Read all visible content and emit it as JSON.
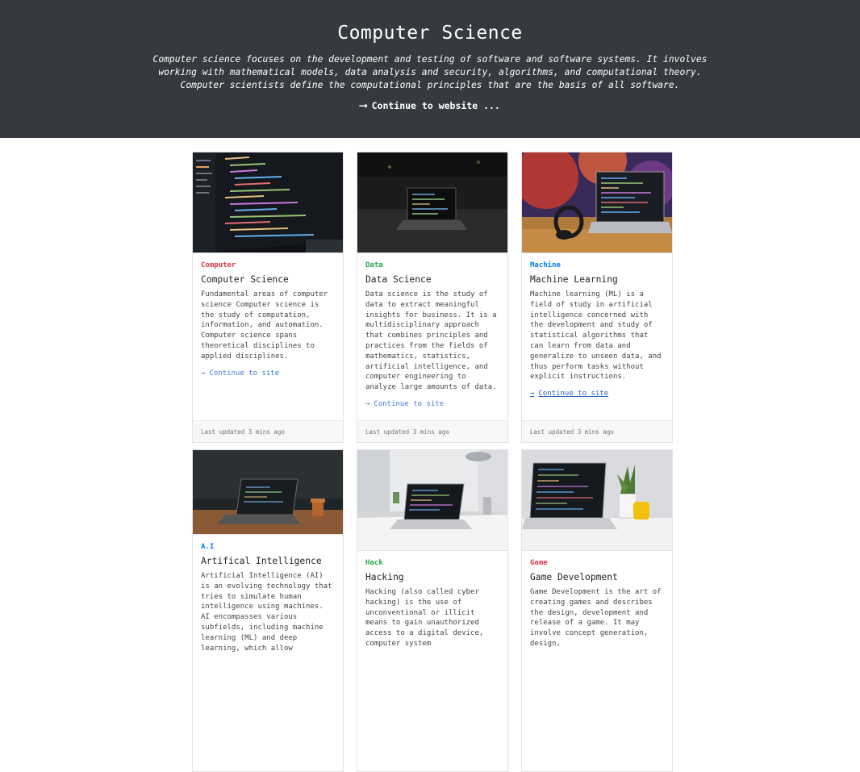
{
  "hero": {
    "title": "Computer Science",
    "description": "Computer science focuses on the development and testing of software and software systems. It involves working with mathematical models, data analysis and security, algorithms, and computational theory. Computer scientists define the computational principles that are the basis of all software.",
    "cta_label": "Continue to website ..."
  },
  "cards": [
    {
      "tag": "Computer",
      "tag_color": "#dc3545",
      "title": "Computer Science",
      "description": "Fundamental areas of computer science Computer science is the study of computation, information, and automation. Computer science spans theoretical disciplines to applied disciplines.",
      "link": "Continue to site",
      "footer": "Last updated 3 mins ago",
      "image": "code-on-monitor-photo"
    },
    {
      "tag": "Data",
      "tag_color": "#28a745",
      "title": "Data Science",
      "description": "Data science is the study of data to extract meaningful insights for business. It is a multidisciplinary approach that combines principles and practices from the fields of mathematics, statistics, artificial intelligence, and computer engineering to analyze large amounts of data.",
      "link": "Continue to site",
      "footer": "Last updated 3 mins ago",
      "image": "laptop-on-dark-ground-photo"
    },
    {
      "tag": "Machine",
      "tag_color": "#007bff",
      "title": "Machine Learning",
      "description": "Machine learning (ML) is a field of study in artificial intelligence concerned with the development and study of statistical algorithms that can learn from data and generalize to unseen data, and thus perform tasks without explicit instructions.",
      "link": "Continue to site",
      "footer": "Last updated 3 mins ago",
      "image": "laptop-with-headphones-photo"
    },
    {
      "tag": "A.I",
      "tag_color": "#007bff",
      "title": "Artifical Intelligence",
      "description": "Artificial Intelligence (AI) is an evolving technology that tries to simulate human intelligence using machines. AI encompasses various subfields, including machine learning (ML) and deep learning, which allow",
      "image": "laptop-on-wooden-desk-photo"
    },
    {
      "tag": "Hack",
      "tag_color": "#28a745",
      "title": "Hacking",
      "description": "Hacking (also called cyber hacking) is the use of unconventional or illicit means to gain unauthorized access to a digital device, computer system",
      "image": "laptop-on-white-desk-photo"
    },
    {
      "tag": "Game",
      "tag_color": "#dc3545",
      "title": "Game Development",
      "description": "Game Development is the art of creating games and describes the design, development and release of a game. It may involve concept generation, design,",
      "image": "laptop-with-plant-photo"
    }
  ]
}
